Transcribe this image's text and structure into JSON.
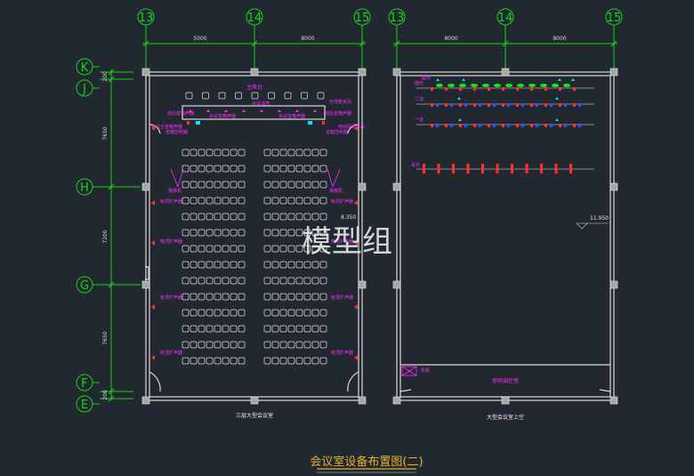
{
  "column_axes_left": [
    "13",
    "14",
    "15"
  ],
  "column_axes_right": [
    "13",
    "14",
    "15"
  ],
  "row_axes": [
    "K",
    "J",
    "H",
    "G",
    "F",
    "E"
  ],
  "dims_top_left": [
    "5000",
    "8000"
  ],
  "dims_top_right": [
    "8000",
    "8000"
  ],
  "dims_left_vertical": [
    "200",
    "7650",
    "7200",
    "7650",
    "200"
  ],
  "left_plan": {
    "stage_label": "主席台",
    "labels": [
      "会议话筒",
      "前后音箱声器",
      "会议音箱声器",
      "会议主音箱声器",
      "无线麦克风",
      "音箱控制器",
      "电动投影幕布",
      "电动投影幕布",
      "摄像机",
      "摄像机",
      "吸顶扩声器",
      "吸顶扩声器",
      "吸顶扩声器",
      "吸顶扩声器",
      "吸顶扩声器",
      "吸顶扩声器",
      "吸顶扩声器",
      "吸顶扩声器"
    ],
    "elevation_mark": "8.350",
    "caption": "三层大型会议室"
  },
  "right_plan": {
    "row_labels": [
      "面光",
      "二道",
      "一道",
      "耳光"
    ],
    "elevation_mark": "11.950",
    "control_room": "音响调控室",
    "control_note": "机柜",
    "caption": "大型会议室上空"
  },
  "watermark": "模型组",
  "drawing_title": "会议室设备布置图(二)"
}
